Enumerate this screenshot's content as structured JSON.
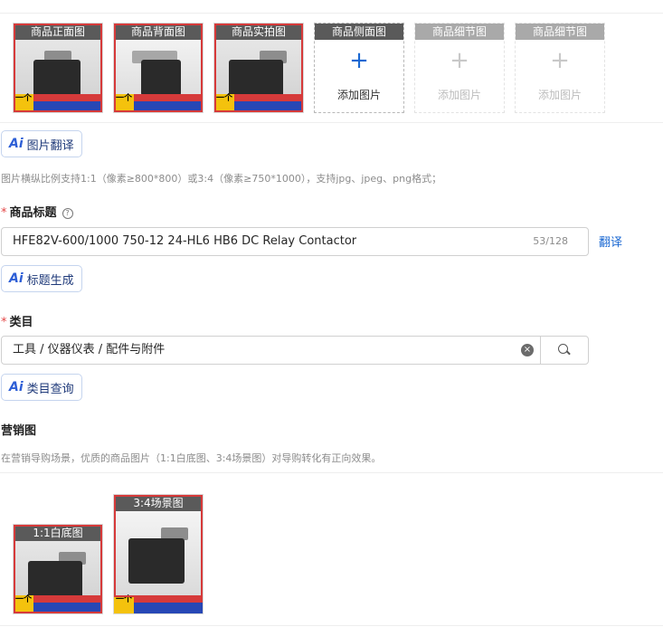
{
  "images": {
    "filled": [
      {
        "caption": "商品正面图"
      },
      {
        "caption": "商品背面图"
      },
      {
        "caption": "商品实拍图"
      }
    ],
    "slots": [
      {
        "caption": "商品侧面图",
        "add_label": "添加图片",
        "plus": "+"
      },
      {
        "caption": "商品细节图",
        "add_label": "添加图片",
        "plus": "+"
      },
      {
        "caption": "商品细节图",
        "add_label": "添加图片",
        "plus": "+"
      }
    ],
    "watermark_text": "一个"
  },
  "ai_buttons": {
    "ai_glyph": "Ai",
    "image_translate": "图片翻译",
    "title_generate": "标题生成",
    "category_query": "类目查询"
  },
  "image_hint": "图片横纵比例支持1:1（像素≥800*800）或3:4（像素≥750*1000），支持jpg、jpeg、png格式；",
  "title_field": {
    "required_mark": "*",
    "label": "商品标题",
    "help_icon": "?",
    "value": "HFE82V-600/1000 750-12 24-HL6 HB6 DC Relay Contactor",
    "counter": "53/128",
    "translate_link": "翻译"
  },
  "category_field": {
    "required_mark": "*",
    "label": "类目",
    "value": "工具 / 仪器仪表 / 配件与附件",
    "clear_icon": "×"
  },
  "marketing": {
    "label": "营销图",
    "hint": "在营销导购场景，优质的商品图片（1:1白底图、3:4场景图）对导购转化有正向效果。",
    "images": [
      {
        "caption": "1:1白底图"
      },
      {
        "caption": "3:4场景图"
      }
    ]
  },
  "colors": {
    "accent": "#1967d2",
    "required": "#e34545",
    "caption_bg": "#5a5a5a"
  }
}
